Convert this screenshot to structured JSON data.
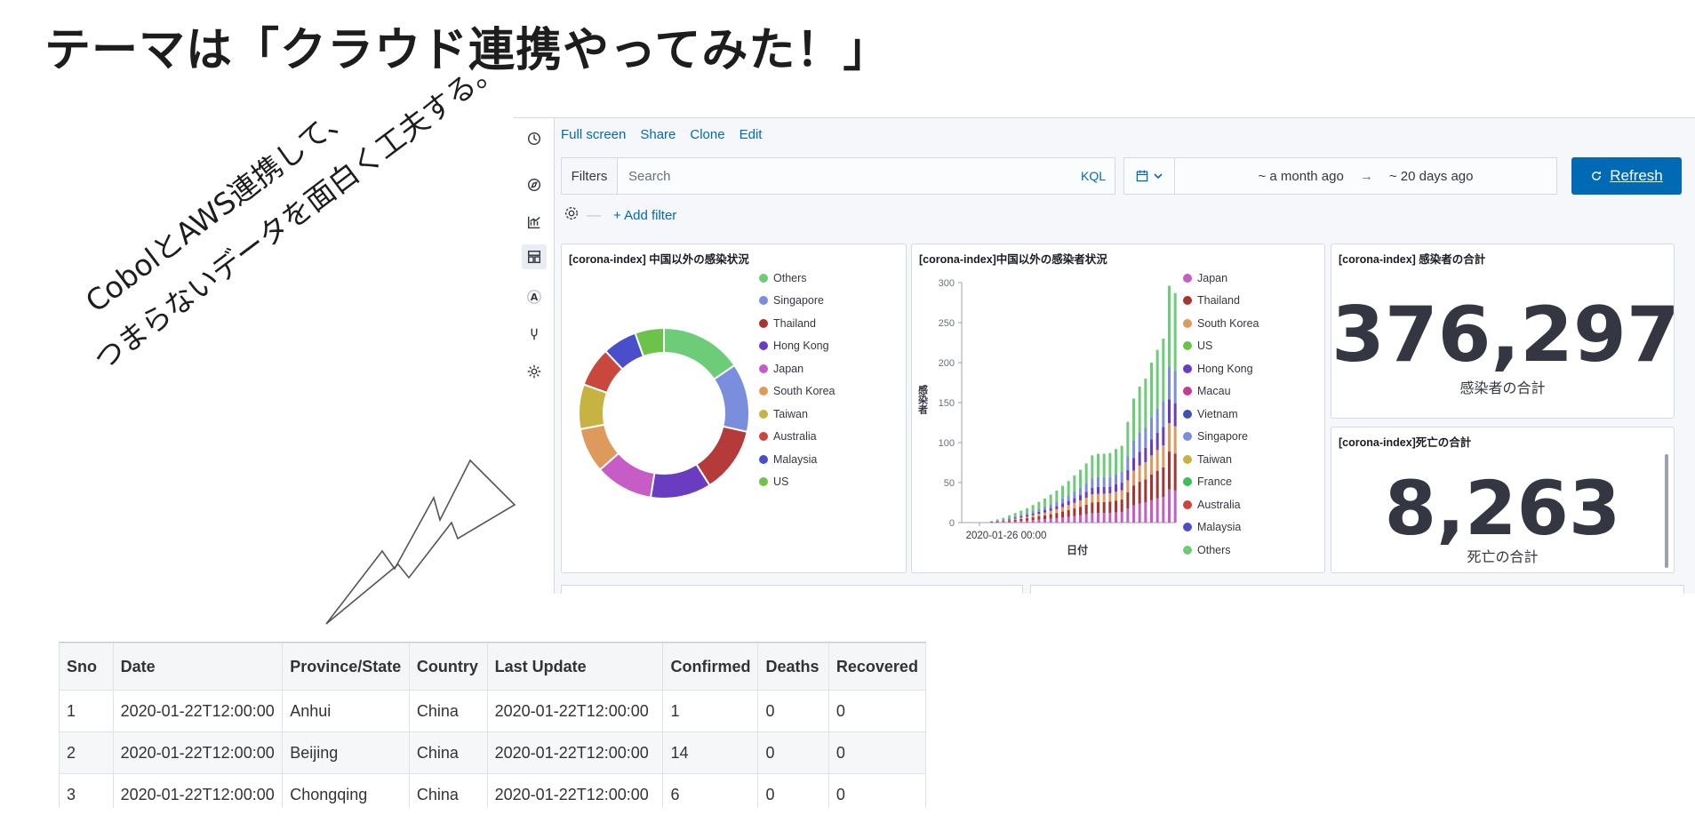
{
  "slide": {
    "title": "テーマは「クラウド連携やってみた！」",
    "annotation_line1": "CobolとAWS連携して、",
    "annotation_line2": "つまらないデータを面白く工夫する。"
  },
  "kibana": {
    "top_menu": [
      "Full screen",
      "Share",
      "Clone",
      "Edit"
    ],
    "query": {
      "filters_label": "Filters",
      "search_placeholder": "Search",
      "kql_label": "KQL"
    },
    "time": {
      "start": "~ a month ago",
      "arrow": "→",
      "end": "~ 20 days ago"
    },
    "refresh_label": "Refresh",
    "add_filter_label": "+ Add filter",
    "nav_icons": [
      "clock-icon",
      "compass-icon",
      "visualize-icon",
      "dashboard-icon",
      "canvas-icon",
      "dev-tools-icon",
      "settings-icon"
    ],
    "canvas_letter": "A",
    "panels": {
      "donut_title": "[corona-index] 中国以外の感染状況",
      "bar_title": "[corona-index]中国以外の感染者状況",
      "confirmed_title": "[corona-index] 感染者の合計",
      "confirmed_value": "376,297",
      "confirmed_label": "感染者の合計",
      "deaths_title": "[corona-index]死亡の合計",
      "deaths_value": "8,263",
      "deaths_label": "死亡の合計"
    }
  },
  "chart_data": [
    {
      "type": "pie",
      "title": "[corona-index] 中国以外の感染状況",
      "legend": [
        "Others",
        "Singapore",
        "Thailand",
        "Hong Kong",
        "Japan",
        "South Korea",
        "Taiwan",
        "Australia",
        "Malaysia",
        "US"
      ],
      "colors": [
        "#54b399",
        "#6092c0",
        "#d36086",
        "#9170b8",
        "#ca8eae",
        "#d6bf57",
        "#b9a888",
        "#da8b45",
        "#aa6556",
        "#e7664c"
      ],
      "values": [
        0.155,
        0.13,
        0.125,
        0.115,
        0.11,
        0.085,
        0.085,
        0.075,
        0.065,
        0.055
      ],
      "slice_colors": [
        "#6dcc78",
        "#7b8ede",
        "#b53a3a",
        "#6a3cc0",
        "#c65cc6",
        "#de9a5c",
        "#c7b342",
        "#c9473d",
        "#4a4ecb",
        "#6dc34a"
      ],
      "legend_colors": [
        "#6dcc78",
        "#7b8ede",
        "#a8332f",
        "#6a3cc0",
        "#c65cc6",
        "#de9a5c",
        "#c7b342",
        "#c9473d",
        "#4a4ecb",
        "#6dc34a"
      ]
    },
    {
      "type": "bar",
      "title": "[corona-index]中国以外の感染者状況",
      "xlabel": "日付",
      "ylabel": "感染者",
      "x_tick": "2020-01-26 00:00",
      "ylim": [
        0,
        300
      ],
      "yticks": [
        0,
        50,
        100,
        150,
        200,
        250,
        300
      ],
      "legend": [
        "Japan",
        "Thailand",
        "South Korea",
        "US",
        "Hong Kong",
        "Macau",
        "Vietnam",
        "Singapore",
        "Taiwan",
        "France",
        "Australia",
        "Malaysia",
        "Others"
      ],
      "legend_colors": [
        "#c65cc6",
        "#a8332f",
        "#de9a5c",
        "#6dc34a",
        "#6a3cc0",
        "#c33f8b",
        "#3f50b5",
        "#7b8ede",
        "#c7b342",
        "#3dbd5a",
        "#c9473d",
        "#4a4ecb",
        "#6dcc78"
      ],
      "totals": [
        2,
        4,
        6,
        9,
        12,
        15,
        18,
        22,
        26,
        30,
        35,
        40,
        46,
        52,
        59,
        66,
        74,
        84,
        86,
        86,
        87,
        92,
        96,
        126,
        155,
        170,
        180,
        200,
        216,
        230,
        296,
        287,
        291
      ]
    }
  ],
  "csv_table": {
    "columns": [
      "Sno",
      "Date",
      "Province/State",
      "Country",
      "Last Update",
      "Confirmed",
      "Deaths",
      "Recovered"
    ],
    "rows": [
      [
        "1",
        "2020-01-22T12:00:00",
        "Anhui",
        "China",
        "2020-01-22T12:00:00",
        "1",
        "0",
        "0"
      ],
      [
        "2",
        "2020-01-22T12:00:00",
        "Beijing",
        "China",
        "2020-01-22T12:00:00",
        "14",
        "0",
        "0"
      ],
      [
        "3",
        "2020-01-22T12:00:00",
        "Chongqing",
        "China",
        "2020-01-22T12:00:00",
        "6",
        "0",
        "0"
      ]
    ]
  }
}
